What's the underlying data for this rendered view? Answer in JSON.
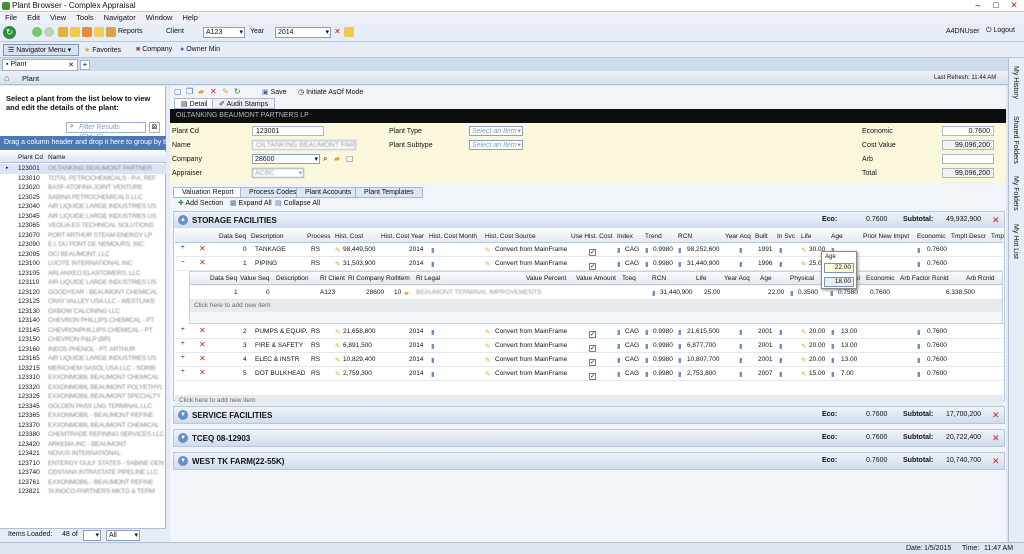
{
  "window": {
    "title": "Plant Browser - Complex Appraisal",
    "user": "A4DNUser",
    "logout": "Logout"
  },
  "menu": [
    "File",
    "Edit",
    "View",
    "Tools",
    "Navigator",
    "Window",
    "Help"
  ],
  "toolbar": {
    "reports": "Reports",
    "client_label": "Client",
    "client_value": "A123",
    "year_label": "Year",
    "year_value": "2014"
  },
  "nav": {
    "navigator_menu": "Navigator Menu",
    "favorites": "Favorites",
    "company": "Company",
    "owner_min": "Owner Min"
  },
  "tab": {
    "plant": "Plant"
  },
  "plantbar": {
    "title": "Plant",
    "last_refresh": "Last Refresh: 11:44 AM"
  },
  "left": {
    "instruction": "Select a plant from the list below to view and edit the details of the plant:",
    "search_placeholder": "Filter Results (Ctrl+F)",
    "drag_hint": "Drag a column header and drop it here to group by that column",
    "col_code": "Plant Cd",
    "col_name": "Name",
    "plants": [
      {
        "cd": "123001",
        "nm": "OILTANKING BEAUMONT PARTNER"
      },
      {
        "cd": "123010",
        "nm": "TOTAL PETROCHEMICALS - P.A. REF"
      },
      {
        "cd": "123020",
        "nm": "BASF-ATOFINA JOINT VENTURE"
      },
      {
        "cd": "123025",
        "nm": "SABINA PETROCHEMICALS LLC"
      },
      {
        "cd": "123040",
        "nm": "AIR LIQUIDE LARGE INDUSTRIES US"
      },
      {
        "cd": "123045",
        "nm": "AIR LIQUIDE LARGE INDUSTRIES US"
      },
      {
        "cd": "123065",
        "nm": "VEOLIA ES TECHNICAL SOLUTIONS"
      },
      {
        "cd": "123070",
        "nm": "PORT ARTHUR STEAM ENERGY LP"
      },
      {
        "cd": "123090",
        "nm": "E.I. DU PONT DE NEMOURS, INC."
      },
      {
        "cd": "123095",
        "nm": "OCI BEAUMONT, LLC"
      },
      {
        "cd": "123100",
        "nm": "LUCITE INTERNATIONAL INC"
      },
      {
        "cd": "123105",
        "nm": "ARLANXEO ELASTOMERS, LLC"
      },
      {
        "cd": "123110",
        "nm": "AIR LIQUIDE LARGE INDUSTRIES US"
      },
      {
        "cd": "123120",
        "nm": "GOODYEAR - BEAUMONT CHEMICAL"
      },
      {
        "cd": "123125",
        "nm": "CRAY VALLEY USA LLC - WESTLAKE"
      },
      {
        "cd": "123130",
        "nm": "OXBOW CALCINING LLC"
      },
      {
        "cd": "123140",
        "nm": "CHEVRON PHILLIPS CHEMICAL - PT"
      },
      {
        "cd": "123145",
        "nm": "CHEVRONPHILLIPS CHEMICAL - PT"
      },
      {
        "cd": "123150",
        "nm": "CHEVRON P&LP (BR)"
      },
      {
        "cd": "123160",
        "nm": "INEOS PHENOL - PT. ARTHUR"
      },
      {
        "cd": "123165",
        "nm": "AIR LIQUIDE LARGE INDUSTRIES US"
      },
      {
        "cd": "123215",
        "nm": "MERICHEM-SASOL USA LLC - SORBI"
      },
      {
        "cd": "123310",
        "nm": "EXXONMOBIL BEAUMONT CHEMICAL"
      },
      {
        "cd": "123320",
        "nm": "EXXONMOBIL BEAUMONT POLYETHYL"
      },
      {
        "cd": "123325",
        "nm": "EXXONMOBIL BEAUMONT SPECIALTY"
      },
      {
        "cd": "123345",
        "nm": "GOLDEN PASS LNG TERMINAL LLC"
      },
      {
        "cd": "123365",
        "nm": "EXXONMOBIL - BEAUMONT REFINE"
      },
      {
        "cd": "123370",
        "nm": "EXXONMOBIL BEAUMONT CHEMICAL"
      },
      {
        "cd": "123380",
        "nm": "CHEMTRADE REFINING SERVICES LLC"
      },
      {
        "cd": "123420",
        "nm": "ARKEMA INC - BEAUMONT"
      },
      {
        "cd": "123421",
        "nm": "NOVUS INTERNATIONAL"
      },
      {
        "cd": "123710",
        "nm": "ENTERGY GULF STATES - SABINE GEN"
      },
      {
        "cd": "123740",
        "nm": "CENTANA INTRASTATE PIPELINE LLC"
      },
      {
        "cd": "123761",
        "nm": "EXXONMOBIL - BEAUMONT REFINE"
      },
      {
        "cd": "123821",
        "nm": "SUNOCO PARTNERS MKTG & TERM"
      }
    ],
    "items_loaded_label": "Items Loaded:",
    "items_loaded": "48",
    "items_of": "of",
    "filter_value": "All"
  },
  "right": {
    "save": "Save",
    "initiate": "Initiate AsOf Mode",
    "tab_detail": "Detail",
    "tab_audit": "Audit Stamps",
    "banner": "OILTANKING BEAUMONT PARTNERS LP",
    "form": {
      "plant_cd_label": "Plant Cd",
      "plant_cd": "123001",
      "name_label": "Name",
      "name": "OILTANKING BEAUMONT PARTNERS LP",
      "company_label": "Company",
      "company": "28600",
      "appraiser_label": "Appraiser",
      "appraiser": "ACBC",
      "plant_type_label": "Plant Type",
      "plant_type": "Select an Item",
      "plant_subtype_label": "Plant Subtype",
      "plant_subtype": "Select an Item",
      "economic_label": "Economic",
      "economic": "0.7600",
      "cost_value_label": "Cost Value",
      "cost_value": "99,096,200",
      "arb_label": "Arb",
      "arb": "",
      "total_label": "Total",
      "total": "99,096,200"
    },
    "subtabs": [
      "Valuation Report",
      "Process Codes",
      "Plant Accounts",
      "Plant Templates"
    ],
    "add_section": "Add Section",
    "expand_all": "Expand All",
    "collapse_all": "Collapse All",
    "eco_label": "Eco:",
    "subtotal_label": "Subtotal:",
    "sections": [
      {
        "title": "STORAGE FACILITIES",
        "eco": "0.7600",
        "subtotal": "49,932,900"
      },
      {
        "title": "SERVICE FACILITIES",
        "eco": "0.7600",
        "subtotal": "17,700,200"
      },
      {
        "title": "TCEQ 08-12903",
        "eco": "0.7600",
        "subtotal": "20,722,400"
      },
      {
        "title": "WEST TK FARM(22-55K)",
        "eco": "0.7600",
        "subtotal": "10,740,700"
      }
    ],
    "grid_headers": [
      "Data Seq",
      "Description",
      "Process",
      "Hist. Cost",
      "Hist. Cost Year",
      "Hist. Cost Month",
      "Hist. Cost Source",
      "Use Hist. Cost",
      "Index",
      "Trend",
      "RCN",
      "Year Acq",
      "Built",
      "In Svc",
      "Life",
      "Age",
      "Prior New Impvt",
      "Economic",
      "Tmplt Descr",
      "Tmp"
    ],
    "rows": [
      {
        "seq": "0",
        "desc": "TANKAGE",
        "proc": "RS",
        "cost": "98,449,500",
        "year": "2014",
        "src": "Convert from MainFrame",
        "idx": "CAG",
        "trend": "0.9980",
        "rcn": "98,252,600",
        "acq": "",
        "built": "1991",
        "svc": "",
        "life": "30.00",
        "age": "",
        "eco": "0.7600"
      },
      {
        "seq": "1",
        "desc": "PIPING",
        "proc": "RS",
        "cost": "31,503,900",
        "year": "2014",
        "src": "Convert from MainFrame",
        "idx": "CAG",
        "trend": "0.9980",
        "rcn": "31,440,900",
        "acq": "",
        "built": "1996",
        "svc": "",
        "life": "25.00",
        "age": "22.00",
        "eco": "0.7600"
      },
      {
        "seq": "2",
        "desc": "PUMPS & EQUIP.",
        "proc": "RS",
        "cost": "21,658,800",
        "year": "2014",
        "src": "Convert from MainFrame",
        "idx": "CAG",
        "trend": "0.9980",
        "rcn": "21,615,500",
        "acq": "",
        "built": "2001",
        "svc": "",
        "life": "20.00",
        "age": "13.00",
        "eco": "0.7600"
      },
      {
        "seq": "3",
        "desc": "FIRE & SAFETY",
        "proc": "RS",
        "cost": "6,891,500",
        "year": "2014",
        "src": "Convert from MainFrame",
        "idx": "CAG",
        "trend": "0.9980",
        "rcn": "6,877,700",
        "acq": "",
        "built": "2001",
        "svc": "",
        "life": "20.00",
        "age": "13.00",
        "eco": "0.7600"
      },
      {
        "seq": "4",
        "desc": "ELEC & INSTR",
        "proc": "RS",
        "cost": "10,829,400",
        "year": "2014",
        "src": "Convert from MainFrame",
        "idx": "CAG",
        "trend": "0.9980",
        "rcn": "10,807,700",
        "acq": "",
        "built": "2001",
        "svc": "",
        "life": "20.00",
        "age": "13.00",
        "eco": "0.7600"
      },
      {
        "seq": "5",
        "desc": "DOT BULKHEAD",
        "proc": "RS",
        "cost": "2,759,300",
        "year": "2014",
        "src": "Convert from MainFrame",
        "idx": "CAG",
        "trend": "0.9980",
        "rcn": "2,753,800",
        "acq": "",
        "built": "2007",
        "svc": "",
        "life": "15.00",
        "age": "7.00",
        "eco": "0.7600"
      }
    ],
    "sub_headers": [
      "Data Seq",
      "Value Seq",
      "Description",
      "RI Client",
      "RI Company",
      "RollItem",
      "RI Legal",
      "Value Percent",
      "Value Amount",
      "Tceq",
      "RCN",
      "Life",
      "Year Acq",
      "Age",
      "Physical",
      "Functional",
      "Economic",
      "Arb Factor",
      "Rcnld",
      "Arb Rcnld"
    ],
    "sub_row": {
      "dseq": "1",
      "vseq": "0",
      "client": "A123",
      "company": "28600",
      "roll": "10",
      "legal": "BEAUMONT TERMINAL IMPROVEMENTS",
      "rcn": "31,440,900",
      "life": "25.00",
      "age": "22.00",
      "phys": "0.3500",
      "func": "0.7580",
      "eco": "0.7600",
      "rcnld": "6,338,500"
    },
    "add_item": "Click here to add new item",
    "age_popup": {
      "label": "Age",
      "v1": "22.00",
      "v2": "18.00"
    }
  },
  "sidetabs": [
    "My History",
    "Shared Folders",
    "My Folders",
    "My Hot List"
  ],
  "status": {
    "date_label": "Date:",
    "date": "1/5/2015",
    "time_label": "Time:",
    "time": "11:47 AM"
  }
}
